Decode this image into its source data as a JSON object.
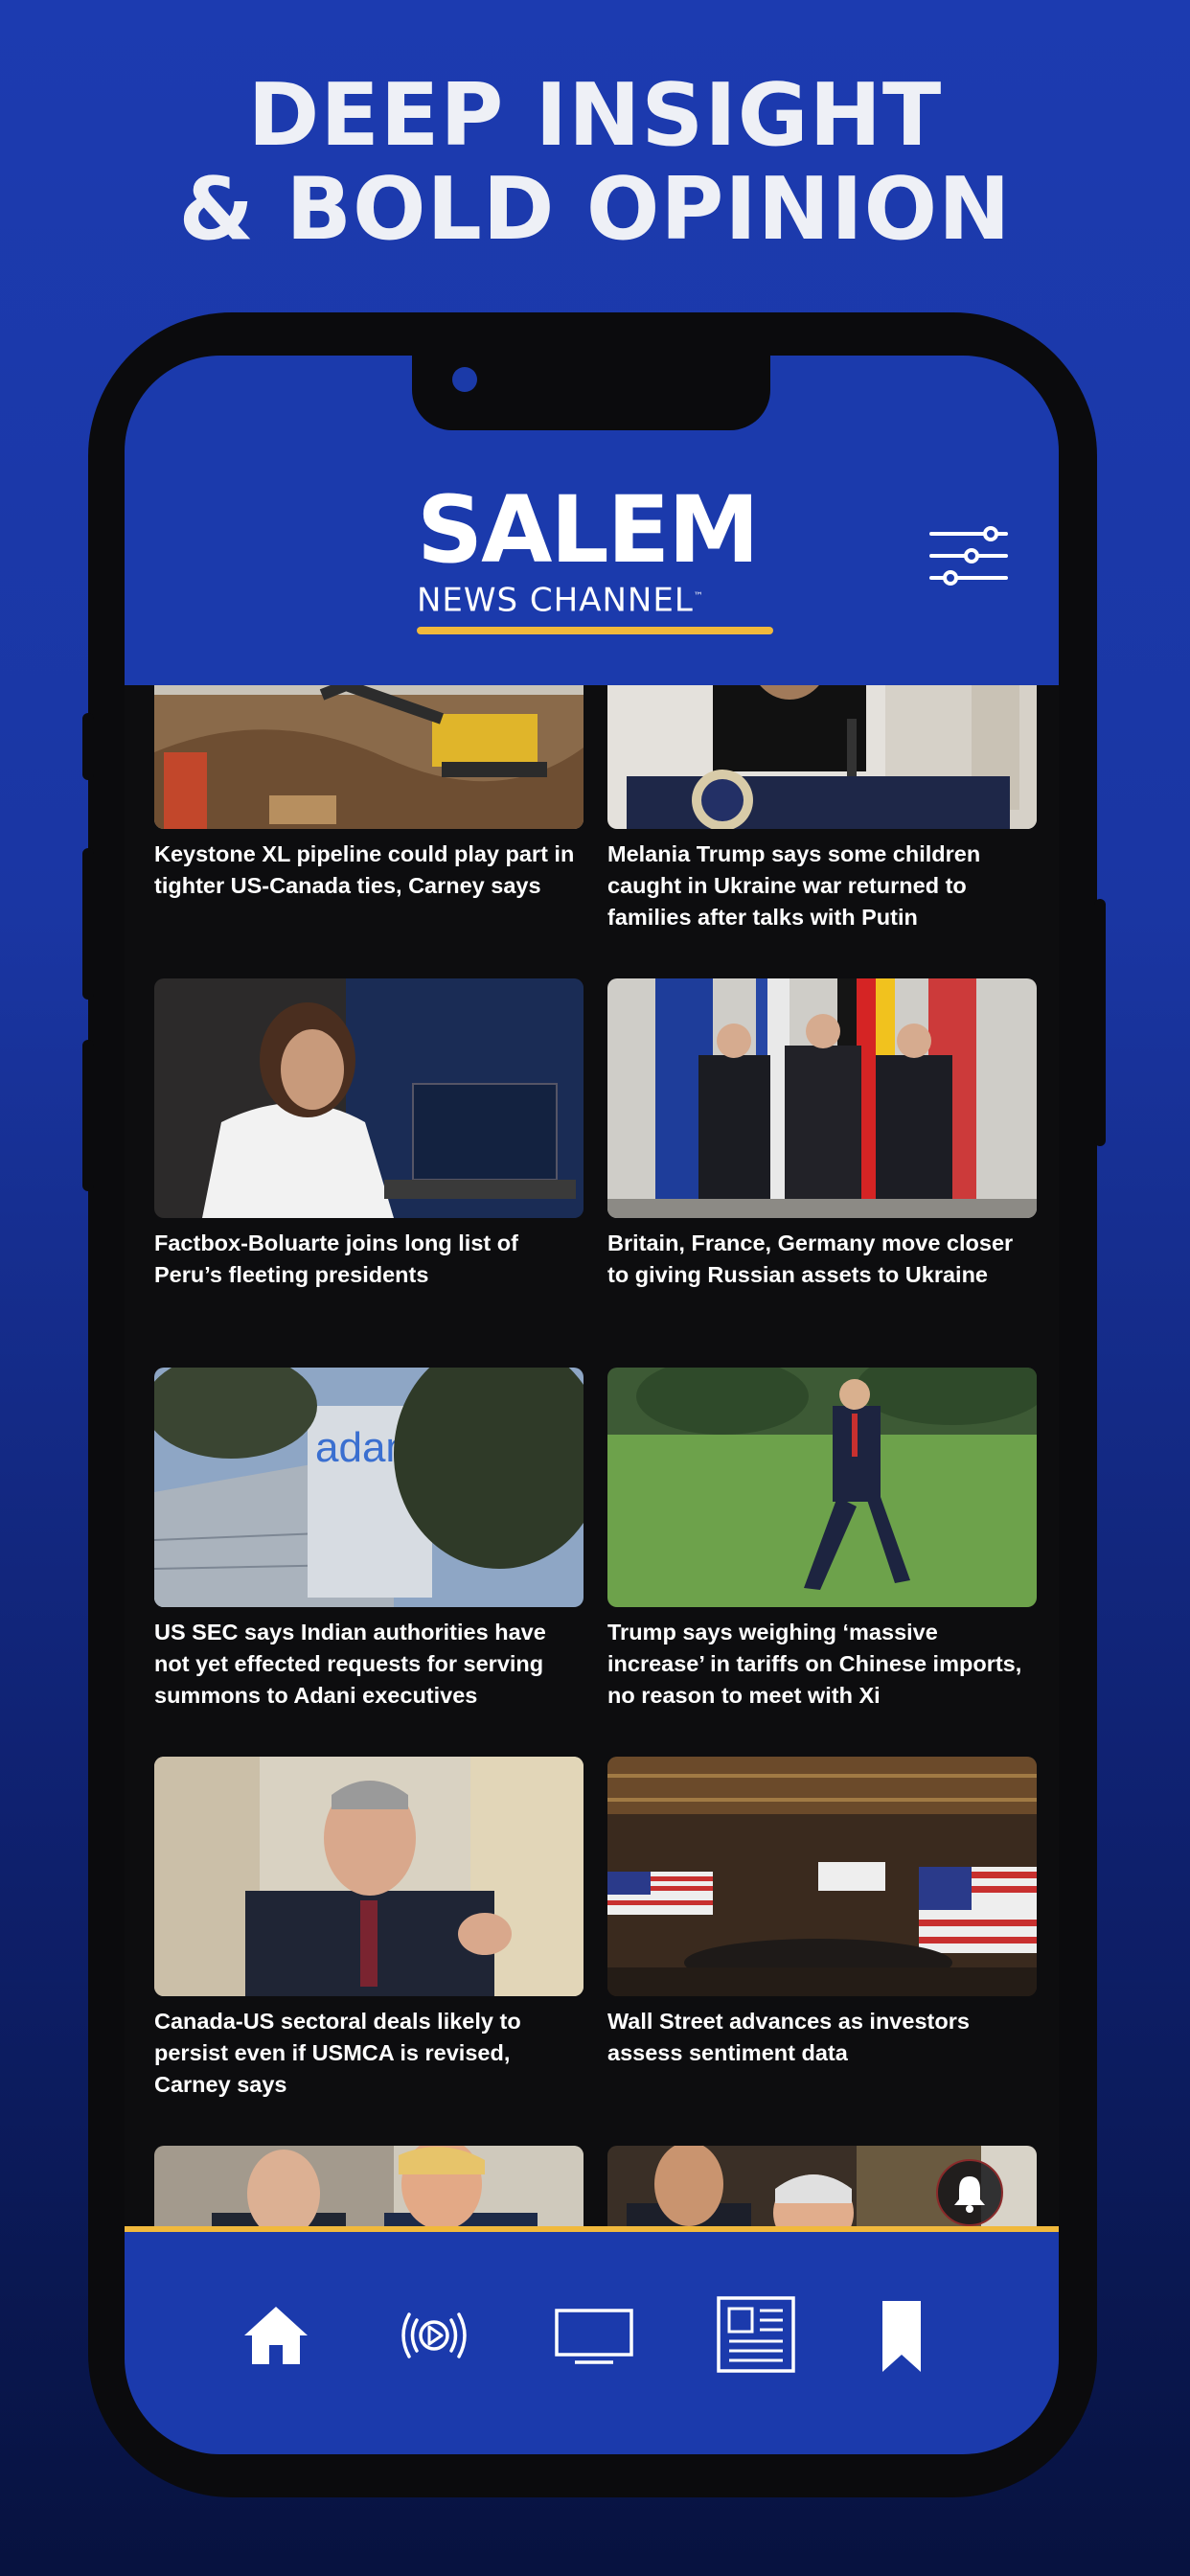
{
  "promo": {
    "headline_line1": "DEEP INSIGHT",
    "headline_line2": "& BOLD OPINION"
  },
  "app": {
    "logo_main": "SALEM",
    "logo_sub": "NEWS CHANNEL",
    "logo_tm": "™",
    "accent_color": "#f1b93c",
    "brand_color": "#1b3aac"
  },
  "articles": [
    {
      "title": "Keystone XL pipeline could play part in tighter US-Canada ties, Carney says",
      "thumb": "excavator-construction"
    },
    {
      "title": "Melania Trump says some children caught in Ukraine war returned to families after talks with Putin",
      "thumb": "podium-speaker"
    },
    {
      "title": "Factbox-Boluarte joins long list of Peru’s fleeting presidents",
      "thumb": "woman-speaking"
    },
    {
      "title": "Britain, France, Germany move closer to giving Russian assets to Ukraine",
      "thumb": "three-leaders-flags"
    },
    {
      "title": "US SEC says Indian authorities have not yet effected requests for serving summons to Adani executives",
      "thumb": "adani-building",
      "sign_text": "adani"
    },
    {
      "title": "Trump says weighing ‘massive increase’ in tariffs on Chinese imports, no reason to meet with Xi",
      "thumb": "man-walking-lawn"
    },
    {
      "title": "Canada-US sectoral deals likely to persist even if USMCA is revised, Carney says",
      "thumb": "man-gesturing"
    },
    {
      "title": "Wall Street advances as investors assess sentiment data",
      "thumb": "stock-exchange-floor"
    },
    {
      "title": "",
      "thumb": "leaders-handshake"
    },
    {
      "title": "",
      "thumb": "meeting-room"
    }
  ],
  "tabs": [
    {
      "name": "home-icon"
    },
    {
      "name": "live-icon"
    },
    {
      "name": "tv-icon"
    },
    {
      "name": "news-icon"
    },
    {
      "name": "bookmark-icon"
    }
  ]
}
